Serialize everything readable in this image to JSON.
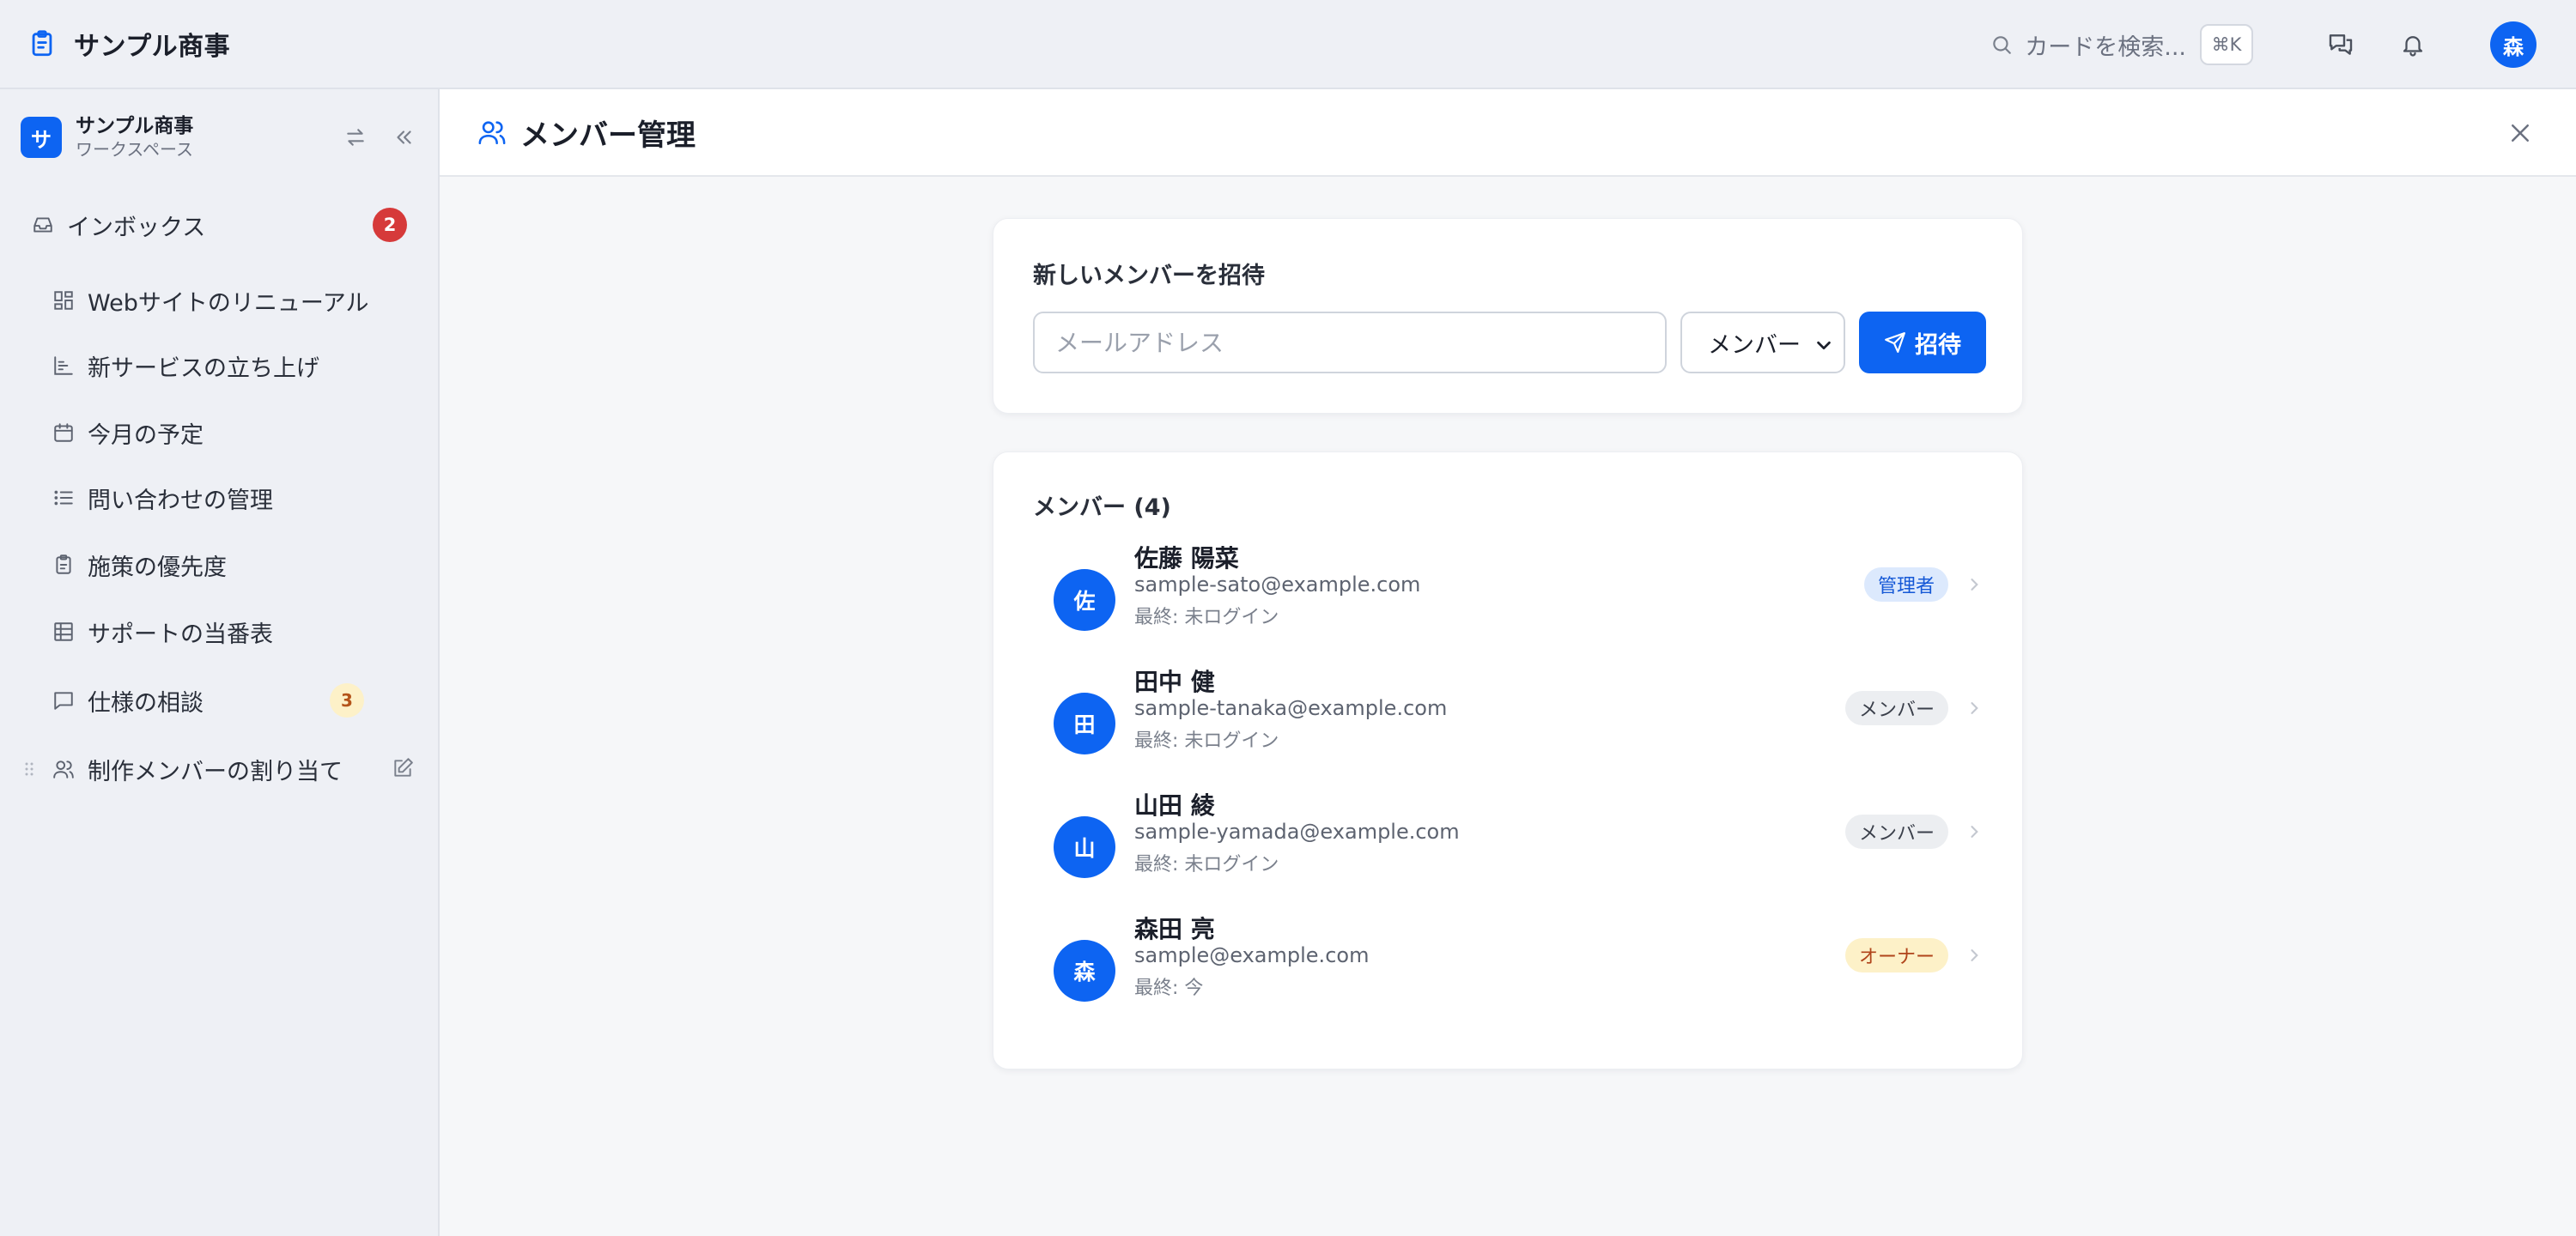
{
  "app": {
    "title": "サンプル商事"
  },
  "topbar": {
    "search_placeholder": "カードを検索...",
    "shortcut": "⌘K",
    "user_initial": "森"
  },
  "workspace": {
    "logo": "サ",
    "name": "サンプル商事",
    "type": "ワークスペース"
  },
  "sidebar": {
    "inbox": {
      "label": "インボックス",
      "count": "2"
    },
    "items": [
      {
        "label": "Webサイトのリニューアル",
        "icon": "dashboard-icon"
      },
      {
        "label": "新サービスの立ち上げ",
        "icon": "chart-icon"
      },
      {
        "label": "今月の予定",
        "icon": "calendar-icon"
      },
      {
        "label": "問い合わせの管理",
        "icon": "list-icon"
      },
      {
        "label": "施策の優先度",
        "icon": "clipboard-icon"
      },
      {
        "label": "サポートの当番表",
        "icon": "table-icon"
      },
      {
        "label": "仕様の相談",
        "icon": "chat-icon",
        "badge": "3"
      },
      {
        "label": "制作メンバーの割り当て",
        "icon": "users-icon"
      }
    ]
  },
  "page": {
    "title": "メンバー管理"
  },
  "invite": {
    "title": "新しいメンバーを招待",
    "email_value": "",
    "email_placeholder": "メールアドレス",
    "role_selected": "メンバー",
    "button_label": "招待"
  },
  "members": {
    "title": "メンバー (4)",
    "list": [
      {
        "initial": "佐",
        "name": "佐藤 陽菜",
        "email": "sample-sato@example.com",
        "last": "最終: 未ログイン",
        "role": "管理者",
        "role_type": "admin"
      },
      {
        "initial": "田",
        "name": "田中 健",
        "email": "sample-tanaka@example.com",
        "last": "最終: 未ログイン",
        "role": "メンバー",
        "role_type": "member"
      },
      {
        "initial": "山",
        "name": "山田 綾",
        "email": "sample-yamada@example.com",
        "last": "最終: 未ログイン",
        "role": "メンバー",
        "role_type": "member"
      },
      {
        "initial": "森",
        "name": "森田 亮",
        "email": "sample@example.com",
        "last": "最終: 今",
        "role": "オーナー",
        "role_type": "owner"
      }
    ]
  },
  "colors": {
    "accent": "#0d64f2",
    "badge_red": "#d63a3a",
    "admin_badge_bg": "#dce9fd",
    "owner_badge_bg": "#fdf1c8"
  }
}
